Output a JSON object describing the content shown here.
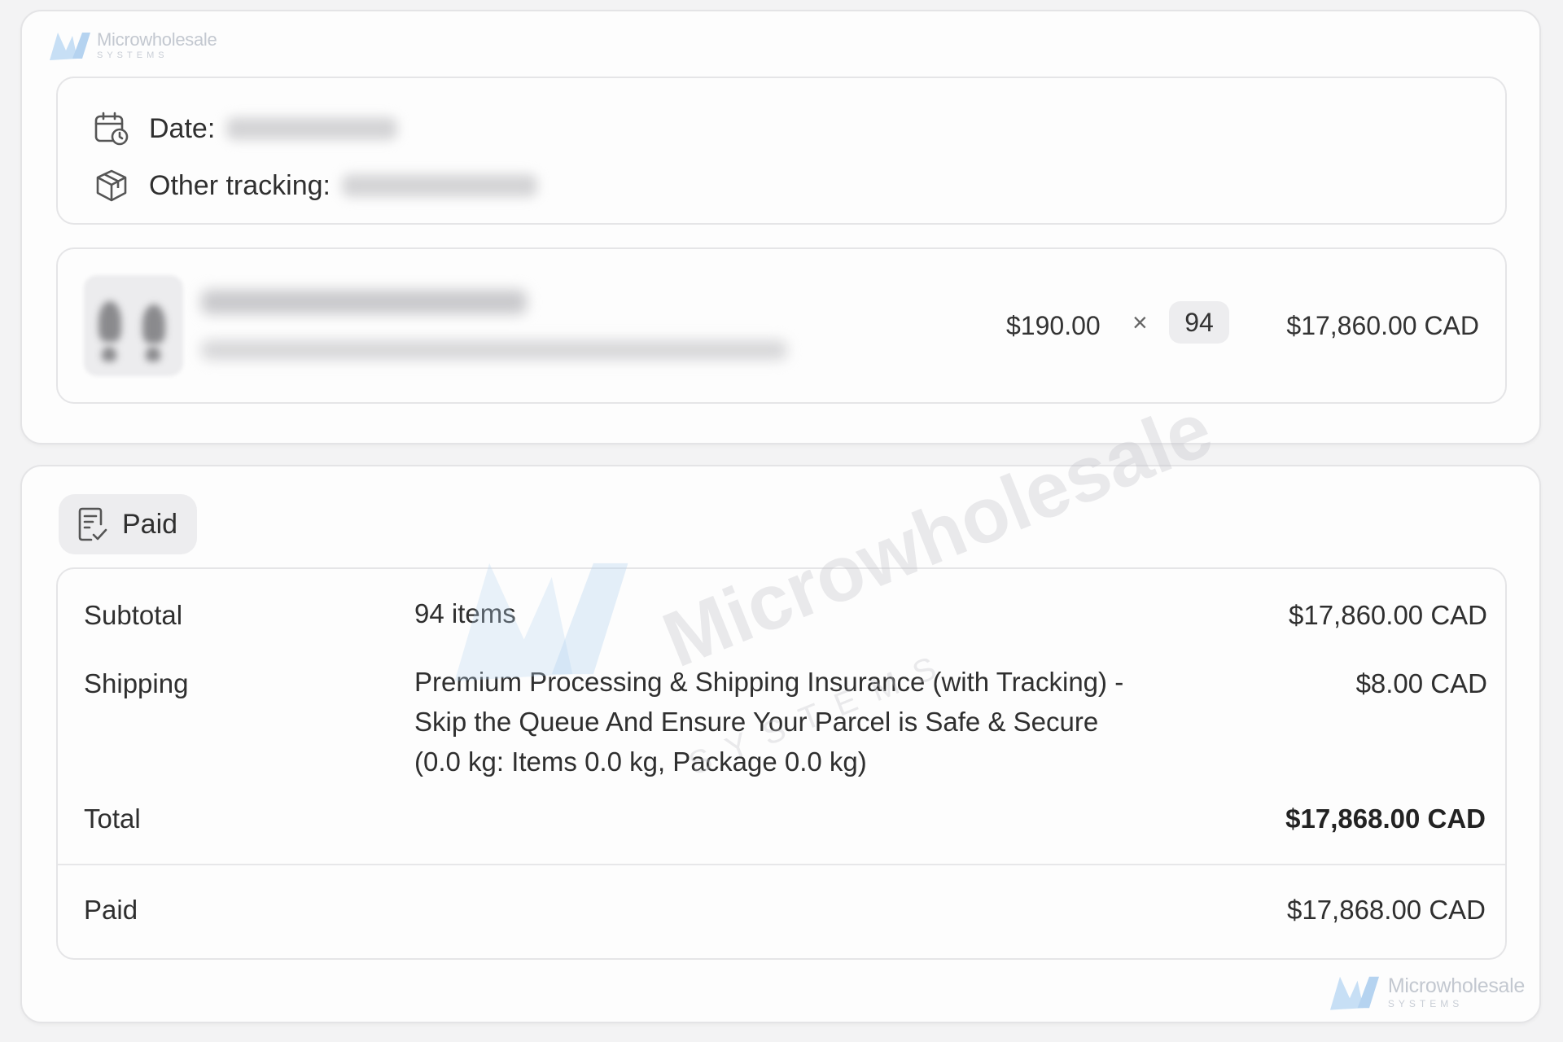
{
  "brand": {
    "name": "Microwholesale",
    "sub": "SYSTEMS",
    "color": "#b9d7f2"
  },
  "order": {
    "date_label": "Date:",
    "tracking_label": "Other tracking:"
  },
  "item": {
    "unit_price": "$190.00",
    "times_symbol": "×",
    "quantity": "94",
    "line_total": "$17,860.00 CAD"
  },
  "payment": {
    "status": "Paid",
    "subtotal_label": "Subtotal",
    "subtotal_items": "94 items",
    "subtotal_value": "$17,860.00 CAD",
    "shipping_label": "Shipping",
    "shipping_lines": [
      "Premium Processing & Shipping Insurance (with Tracking) -",
      "Skip the Queue And Ensure Your Parcel is Safe & Secure",
      "(0.0 kg: Items 0.0 kg, Package 0.0 kg)"
    ],
    "shipping_value": "$8.00 CAD",
    "total_label": "Total",
    "total_value": "$17,868.00 CAD",
    "paid_label": "Paid",
    "paid_value": "$17,868.00 CAD"
  },
  "watermark": {
    "name": "Microwholesale",
    "sub": "SYSTEMS"
  },
  "icons": {
    "date": "calendar-clock-icon",
    "tracking": "package-icon",
    "status": "receipt-check-icon"
  }
}
